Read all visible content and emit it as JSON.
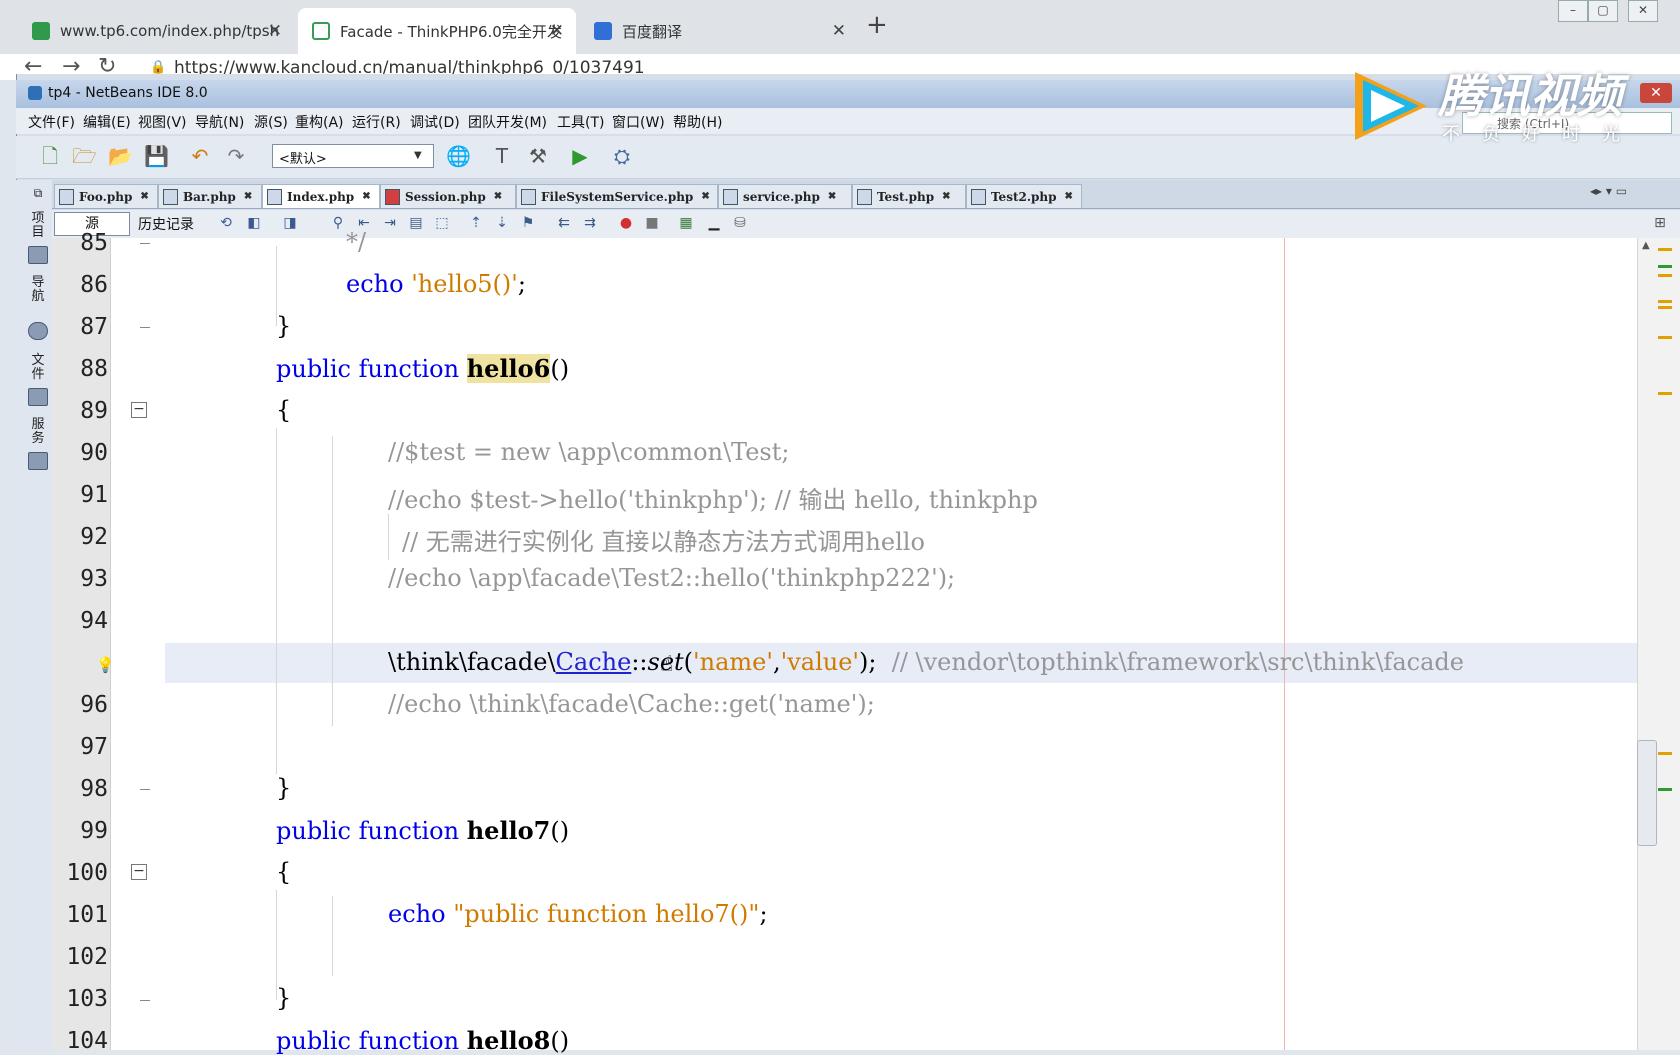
{
  "browser": {
    "tabs": [
      {
        "label": "www.tp6.com/index.php/tpsh",
        "close": "✕"
      },
      {
        "label": "Facade - ThinkPHP6.0完全开发",
        "close": "✕"
      },
      {
        "label": "百度翻译",
        "close": "✕"
      }
    ],
    "new_tab": "+",
    "url": "https://www.kancloud.cn/manual/thinkphp6_0/1037491"
  },
  "ide": {
    "title": "tp4 - NetBeans IDE 8.0",
    "menu": [
      "文件(F)",
      "编辑(E)",
      "视图(V)",
      "导航(N)",
      "源(S)",
      "重构(A)",
      "运行(R)",
      "调试(D)",
      "团队开发(M)",
      "工具(T)",
      "窗口(W)",
      "帮助(H)"
    ],
    "search_placeholder": "搜索 (Ctrl+I)",
    "config": "<默认>",
    "side_panels": [
      "项目",
      "导航",
      "文件",
      "服务"
    ],
    "tabs": [
      "Foo.php",
      "Bar.php",
      "Index.php",
      "Session.php",
      "FileSystemService.php",
      "service.php",
      "Test.php",
      "Test2.php"
    ],
    "active_tab": "Index.php",
    "source_button": "源",
    "history_button": "历史记录"
  },
  "code": {
    "line_numbers": [
      "85",
      "86",
      "87",
      "88",
      "89",
      "90",
      "91",
      "92",
      "93",
      "94",
      "",
      "96",
      "97",
      "98",
      "99",
      "100",
      "101",
      "102",
      "103",
      "104"
    ],
    "l85": "*/",
    "l86_kw": "echo",
    "l86_str": "'hello5()'",
    "l86_end": ";",
    "l87": "}",
    "l88_kw": "public function",
    "l88_fn": "hello6",
    "l88_end": "()",
    "l89": "{",
    "l90": "//$test = new \\app\\common\\Test;",
    "l91": "//echo $test->hello('thinkphp'); // 输出 hello, thinkphp",
    "l92": "// 无需进行实例化 直接以静态方法方式调用hello",
    "l93": "//echo \\app\\facade\\Test2::hello('thinkphp222');",
    "l95_ns": "\\think\\facade\\",
    "l95_cls": "Cache",
    "l95_op": "::",
    "l95_m": "set",
    "l95_open": "(",
    "l95_s1": "'name'",
    "l95_comma": ",",
    "l95_s2": "'value'",
    "l95_close": ");",
    "l95_cm": "// \\vendor\\topthink\\framework\\src\\think\\facade",
    "l96": "//echo \\think\\facade\\Cache::get('name');",
    "l98": "}",
    "l99_kw": "public function",
    "l99_fn": "hello7",
    "l99_end": "()",
    "l100": "{",
    "l101_kw": "echo",
    "l101_str": "\"public function hello7()\"",
    "l101_end": ";",
    "l103": "}",
    "l104_kw": "public function",
    "l104_fn": "hello8",
    "l104_end": "()"
  },
  "watermark": {
    "name": "腾讯视频",
    "slogan": "不负好时光"
  },
  "colors": {
    "keyword": "#0000e6",
    "string": "#ce7b00",
    "comment": "#969696",
    "highlight": "#f0e2a0"
  }
}
